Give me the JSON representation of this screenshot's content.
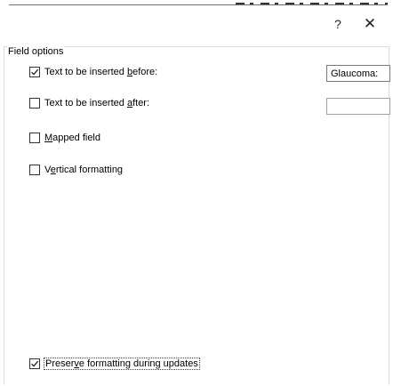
{
  "window": {
    "help_glyph": "?",
    "close_glyph": "✕"
  },
  "field_options": {
    "group_label": "Field options",
    "before": {
      "label_pre": "Text to be inserted ",
      "label_key": "b",
      "label_post": "efore:",
      "checked": true,
      "value": "Glaucoma:"
    },
    "after": {
      "label_pre": "Text to be inserted ",
      "label_key": "a",
      "label_post": "fter:",
      "checked": false,
      "value": ""
    },
    "mapped": {
      "label_pre": "",
      "label_key": "M",
      "label_post": "apped field",
      "checked": false
    },
    "vertical": {
      "label_pre": "V",
      "label_key": "e",
      "label_post": "rtical formatting",
      "checked": false
    }
  },
  "preserve": {
    "label_pre": "Preser",
    "label_key": "v",
    "label_post": "e formatting during updates",
    "checked": true
  },
  "icons": {
    "check": "checkmark-icon",
    "help": "help-icon",
    "close": "close-icon"
  }
}
